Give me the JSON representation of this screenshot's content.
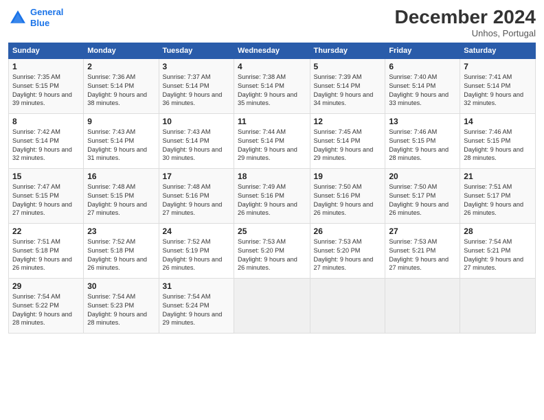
{
  "header": {
    "logo_line1": "General",
    "logo_line2": "Blue",
    "month_title": "December 2024",
    "subtitle": "Unhos, Portugal"
  },
  "days_of_week": [
    "Sunday",
    "Monday",
    "Tuesday",
    "Wednesday",
    "Thursday",
    "Friday",
    "Saturday"
  ],
  "weeks": [
    [
      {
        "day": "1",
        "sunrise": "Sunrise: 7:35 AM",
        "sunset": "Sunset: 5:15 PM",
        "daylight": "Daylight: 9 hours and 39 minutes."
      },
      {
        "day": "2",
        "sunrise": "Sunrise: 7:36 AM",
        "sunset": "Sunset: 5:14 PM",
        "daylight": "Daylight: 9 hours and 38 minutes."
      },
      {
        "day": "3",
        "sunrise": "Sunrise: 7:37 AM",
        "sunset": "Sunset: 5:14 PM",
        "daylight": "Daylight: 9 hours and 36 minutes."
      },
      {
        "day": "4",
        "sunrise": "Sunrise: 7:38 AM",
        "sunset": "Sunset: 5:14 PM",
        "daylight": "Daylight: 9 hours and 35 minutes."
      },
      {
        "day": "5",
        "sunrise": "Sunrise: 7:39 AM",
        "sunset": "Sunset: 5:14 PM",
        "daylight": "Daylight: 9 hours and 34 minutes."
      },
      {
        "day": "6",
        "sunrise": "Sunrise: 7:40 AM",
        "sunset": "Sunset: 5:14 PM",
        "daylight": "Daylight: 9 hours and 33 minutes."
      },
      {
        "day": "7",
        "sunrise": "Sunrise: 7:41 AM",
        "sunset": "Sunset: 5:14 PM",
        "daylight": "Daylight: 9 hours and 32 minutes."
      }
    ],
    [
      {
        "day": "8",
        "sunrise": "Sunrise: 7:42 AM",
        "sunset": "Sunset: 5:14 PM",
        "daylight": "Daylight: 9 hours and 32 minutes."
      },
      {
        "day": "9",
        "sunrise": "Sunrise: 7:43 AM",
        "sunset": "Sunset: 5:14 PM",
        "daylight": "Daylight: 9 hours and 31 minutes."
      },
      {
        "day": "10",
        "sunrise": "Sunrise: 7:43 AM",
        "sunset": "Sunset: 5:14 PM",
        "daylight": "Daylight: 9 hours and 30 minutes."
      },
      {
        "day": "11",
        "sunrise": "Sunrise: 7:44 AM",
        "sunset": "Sunset: 5:14 PM",
        "daylight": "Daylight: 9 hours and 29 minutes."
      },
      {
        "day": "12",
        "sunrise": "Sunrise: 7:45 AM",
        "sunset": "Sunset: 5:14 PM",
        "daylight": "Daylight: 9 hours and 29 minutes."
      },
      {
        "day": "13",
        "sunrise": "Sunrise: 7:46 AM",
        "sunset": "Sunset: 5:15 PM",
        "daylight": "Daylight: 9 hours and 28 minutes."
      },
      {
        "day": "14",
        "sunrise": "Sunrise: 7:46 AM",
        "sunset": "Sunset: 5:15 PM",
        "daylight": "Daylight: 9 hours and 28 minutes."
      }
    ],
    [
      {
        "day": "15",
        "sunrise": "Sunrise: 7:47 AM",
        "sunset": "Sunset: 5:15 PM",
        "daylight": "Daylight: 9 hours and 27 minutes."
      },
      {
        "day": "16",
        "sunrise": "Sunrise: 7:48 AM",
        "sunset": "Sunset: 5:15 PM",
        "daylight": "Daylight: 9 hours and 27 minutes."
      },
      {
        "day": "17",
        "sunrise": "Sunrise: 7:48 AM",
        "sunset": "Sunset: 5:16 PM",
        "daylight": "Daylight: 9 hours and 27 minutes."
      },
      {
        "day": "18",
        "sunrise": "Sunrise: 7:49 AM",
        "sunset": "Sunset: 5:16 PM",
        "daylight": "Daylight: 9 hours and 26 minutes."
      },
      {
        "day": "19",
        "sunrise": "Sunrise: 7:50 AM",
        "sunset": "Sunset: 5:16 PM",
        "daylight": "Daylight: 9 hours and 26 minutes."
      },
      {
        "day": "20",
        "sunrise": "Sunrise: 7:50 AM",
        "sunset": "Sunset: 5:17 PM",
        "daylight": "Daylight: 9 hours and 26 minutes."
      },
      {
        "day": "21",
        "sunrise": "Sunrise: 7:51 AM",
        "sunset": "Sunset: 5:17 PM",
        "daylight": "Daylight: 9 hours and 26 minutes."
      }
    ],
    [
      {
        "day": "22",
        "sunrise": "Sunrise: 7:51 AM",
        "sunset": "Sunset: 5:18 PM",
        "daylight": "Daylight: 9 hours and 26 minutes."
      },
      {
        "day": "23",
        "sunrise": "Sunrise: 7:52 AM",
        "sunset": "Sunset: 5:18 PM",
        "daylight": "Daylight: 9 hours and 26 minutes."
      },
      {
        "day": "24",
        "sunrise": "Sunrise: 7:52 AM",
        "sunset": "Sunset: 5:19 PM",
        "daylight": "Daylight: 9 hours and 26 minutes."
      },
      {
        "day": "25",
        "sunrise": "Sunrise: 7:53 AM",
        "sunset": "Sunset: 5:20 PM",
        "daylight": "Daylight: 9 hours and 26 minutes."
      },
      {
        "day": "26",
        "sunrise": "Sunrise: 7:53 AM",
        "sunset": "Sunset: 5:20 PM",
        "daylight": "Daylight: 9 hours and 27 minutes."
      },
      {
        "day": "27",
        "sunrise": "Sunrise: 7:53 AM",
        "sunset": "Sunset: 5:21 PM",
        "daylight": "Daylight: 9 hours and 27 minutes."
      },
      {
        "day": "28",
        "sunrise": "Sunrise: 7:54 AM",
        "sunset": "Sunset: 5:21 PM",
        "daylight": "Daylight: 9 hours and 27 minutes."
      }
    ],
    [
      {
        "day": "29",
        "sunrise": "Sunrise: 7:54 AM",
        "sunset": "Sunset: 5:22 PM",
        "daylight": "Daylight: 9 hours and 28 minutes."
      },
      {
        "day": "30",
        "sunrise": "Sunrise: 7:54 AM",
        "sunset": "Sunset: 5:23 PM",
        "daylight": "Daylight: 9 hours and 28 minutes."
      },
      {
        "day": "31",
        "sunrise": "Sunrise: 7:54 AM",
        "sunset": "Sunset: 5:24 PM",
        "daylight": "Daylight: 9 hours and 29 minutes."
      },
      null,
      null,
      null,
      null
    ]
  ]
}
